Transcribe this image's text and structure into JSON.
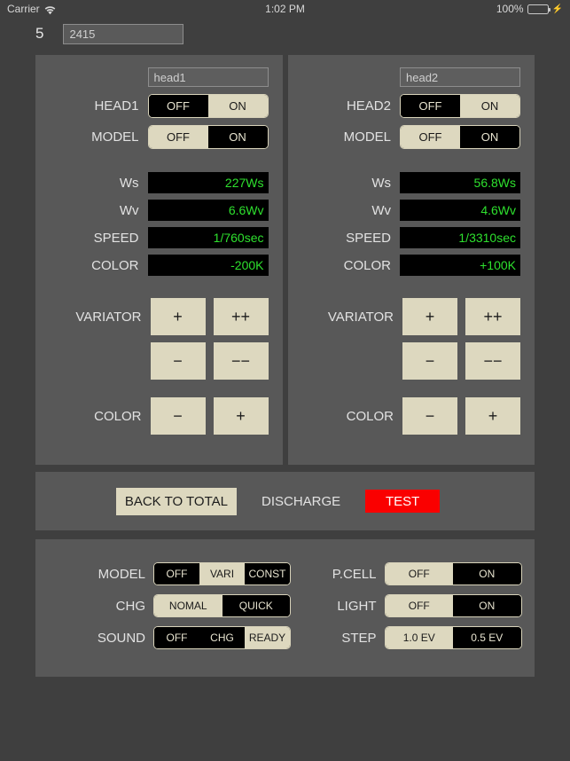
{
  "statusbar": {
    "carrier": "Carrier",
    "wifi_icon": "wifi-icon",
    "time": "1:02 PM",
    "battery_percent": "100%",
    "battery_icon": "battery-full-icon",
    "charging_icon": "lightning-bolt-icon"
  },
  "topbar": {
    "number": "5",
    "value": "2415"
  },
  "heads": [
    {
      "name_field": "head1",
      "power_label": "HEAD1",
      "power_options": [
        "OFF",
        "ON"
      ],
      "power_selected": "ON",
      "model_label": "MODEL",
      "model_options": [
        "OFF",
        "ON"
      ],
      "model_selected": "OFF",
      "values": [
        {
          "label": "Ws",
          "value": "227Ws"
        },
        {
          "label": "Wv",
          "value": "6.6Wv"
        },
        {
          "label": "SPEED",
          "value": "1/760sec"
        },
        {
          "label": "COLOR",
          "value": "-200K"
        }
      ],
      "variator_label": "VARIATOR",
      "variator_up": [
        "+",
        "++"
      ],
      "variator_down": [
        "−",
        "−−"
      ],
      "color_label": "COLOR",
      "color_buttons": [
        "−",
        "+"
      ]
    },
    {
      "name_field": "head2",
      "power_label": "HEAD2",
      "power_options": [
        "OFF",
        "ON"
      ],
      "power_selected": "ON",
      "model_label": "MODEL",
      "model_options": [
        "OFF",
        "ON"
      ],
      "model_selected": "OFF",
      "values": [
        {
          "label": "Ws",
          "value": "56.8Ws"
        },
        {
          "label": "Wv",
          "value": "4.6Wv"
        },
        {
          "label": "SPEED",
          "value": "1/3310sec"
        },
        {
          "label": "COLOR",
          "value": "+100K"
        }
      ],
      "variator_label": "VARIATOR",
      "variator_up": [
        "+",
        "++"
      ],
      "variator_down": [
        "−",
        "−−"
      ],
      "color_label": "COLOR",
      "color_buttons": [
        "−",
        "+"
      ]
    }
  ],
  "actions": {
    "back_to_total": "BACK TO TOTAL",
    "discharge": "DISCHARGE",
    "test": "TEST"
  },
  "settings": {
    "left": [
      {
        "label": "MODEL",
        "options": [
          "OFF",
          "VARI",
          "CONST"
        ],
        "selected": "VARI"
      },
      {
        "label": "CHG",
        "options": [
          "NOMAL",
          "QUICK"
        ],
        "selected": "NOMAL"
      },
      {
        "label": "SOUND",
        "options": [
          "OFF",
          "CHG",
          "READY"
        ],
        "selected": "READY"
      }
    ],
    "right": [
      {
        "label": "P.CELL",
        "options": [
          "OFF",
          "ON"
        ],
        "selected": "OFF"
      },
      {
        "label": "LIGHT",
        "options": [
          "OFF",
          "ON"
        ],
        "selected": "OFF"
      },
      {
        "label": "STEP",
        "options": [
          "1.0 EV",
          "0.5 EV"
        ],
        "selected": "1.0 EV"
      }
    ]
  },
  "colors": {
    "page_bg": "#3f3f3f",
    "panel_bg": "#585858",
    "beige": "#ddd8bf",
    "value_green": "#2ee02e",
    "test_red": "#fa0000",
    "battery_green": "#3bdc4e"
  }
}
